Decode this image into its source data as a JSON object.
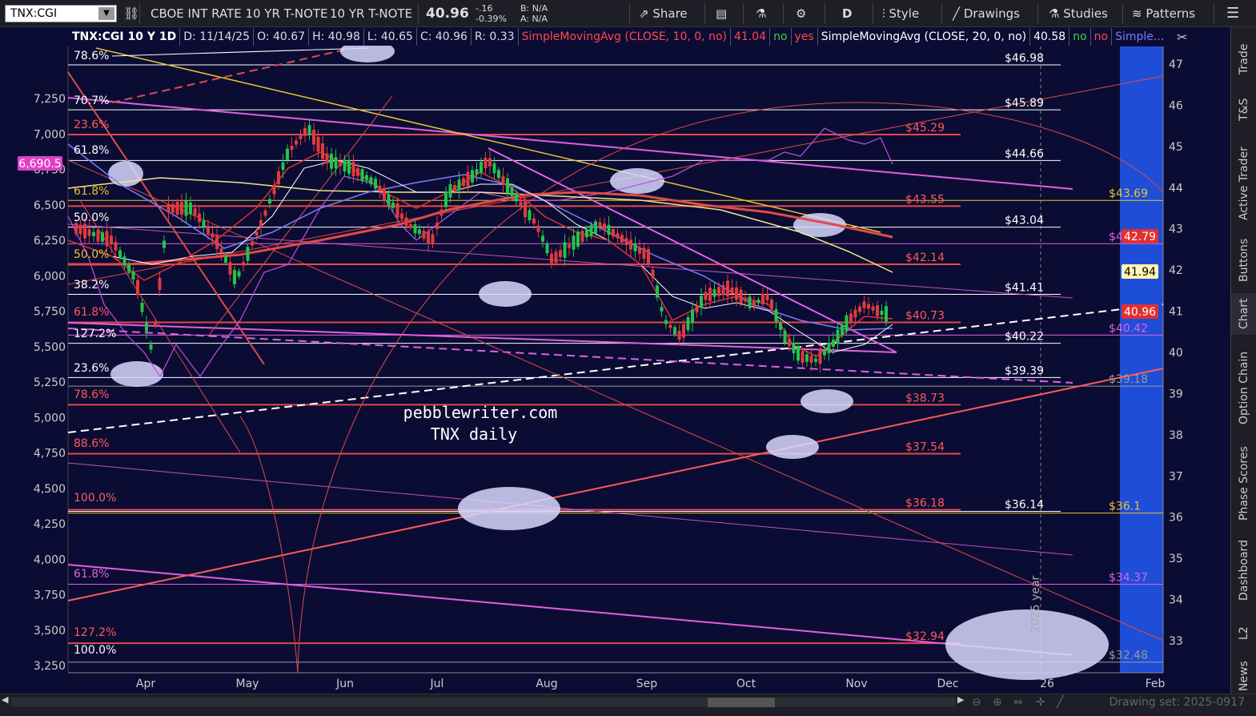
{
  "toolbar": {
    "symbol": "TNX:CGI",
    "description": "CBOE INT RATE 10 YR T-NOTE",
    "short_description": "10 YR T-NOTE",
    "last_price": "40.96",
    "change": "-.16",
    "change_pct": "-0.39%",
    "bid": "B: N/A",
    "ask": "A: N/A",
    "share_label": "Share",
    "period_label": "D",
    "style_label": "Style",
    "drawings_label": "Drawings",
    "studies_label": "Studies",
    "patterns_label": "Patterns"
  },
  "infobar": {
    "title": "TNX:CGI 10 Y 1D",
    "date": "D: 11/14/25",
    "open": "O: 40.67",
    "high": "H: 40.98",
    "low": "L: 40.65",
    "close": "C: 40.96",
    "range": "R: 0.33",
    "study1": "SimpleMovingAvg (CLOSE, 10, 0, no)",
    "study1_val": "41.04",
    "study1_no": "no",
    "study1_yes": "yes",
    "study2": "SimpleMovingAvg (CLOSE, 20, 0, no)",
    "study2_val": "40.58",
    "study2_no1": "no",
    "study2_no2": "no",
    "study3": "Simple..."
  },
  "watermark": {
    "line1": "pebblewriter.com",
    "line2": "TNX daily"
  },
  "year_marker": "2025 year",
  "chart_data": {
    "type": "line",
    "x_ticks": [
      "Apr",
      "May",
      "Jun",
      "Jul",
      "Aug",
      "Sep",
      "Oct",
      "Nov",
      "Dec",
      "26",
      "Feb"
    ],
    "right_axis_ticks": [
      "47",
      "46",
      "45",
      "44",
      "43",
      "42",
      "41",
      "40",
      "39",
      "38",
      "37",
      "36",
      "35",
      "34",
      "33"
    ],
    "left_axis_ticks": [
      "7,250",
      "7,000",
      "6,750",
      "6,500",
      "6,250",
      "6,000",
      "5,750",
      "5,500",
      "5,250",
      "5,000",
      "4,750",
      "4,500",
      "4,250",
      "4,000",
      "3,750",
      "3,500",
      "3,250"
    ],
    "y_right_range": [
      32.5,
      47.5
    ],
    "y_left_range": [
      3200,
      7450
    ],
    "price_labels_white": [
      "$46.98",
      "$45.89",
      "$44.66",
      "$43.04",
      "$41.41",
      "$40.22",
      "$39.39",
      "$36.14"
    ],
    "price_labels_red": [
      "$45.29",
      "$43.55",
      "$42.14",
      "$40.73",
      "$38.73",
      "$37.54",
      "$36.18",
      "$32.94"
    ],
    "price_labels_yellow": [
      "$43.69",
      "$36.1"
    ],
    "price_labels_pink": [
      "$42.64",
      "$40.42",
      "$34.37"
    ],
    "price_labels_faint": [
      "$39.18",
      "$32.48"
    ],
    "fib_labels_white": [
      "78.6%",
      "70.7%",
      "61.8%",
      "50.0%",
      "38.2%",
      "127.2%",
      "23.6%",
      "100.0%"
    ],
    "fib_labels_red": [
      "23.6%",
      "61.8%",
      "78.6%",
      "88.6%",
      "100.0%",
      "127.2%"
    ],
    "fib_labels_yellow": [
      "61.8%",
      "50.0%"
    ],
    "fib_labels_pink": [
      "61.8%"
    ],
    "badges": [
      {
        "text": "6,690.5",
        "bg": "#e040c8",
        "fg": "#ffffff"
      },
      {
        "text": "42.79",
        "bg": "#e03030",
        "fg": "#ffffff"
      },
      {
        "text": "41.94",
        "bg": "#fff5b0",
        "fg": "#000000"
      },
      {
        "text": "40.96",
        "bg": "#e03030",
        "fg": "#ffffff"
      }
    ],
    "colors": {
      "background": "#0b0c33",
      "up_candle": "#21c44a",
      "down_candle": "#e03b3b",
      "sma10": "#e03030",
      "sma20": "#ffffff",
      "sma50": "#7b7bff",
      "sma200": "#f0e68c",
      "spx_line": "#c050e0",
      "future_band": "#1e4ed8"
    }
  },
  "right_panel": {
    "tabs": [
      "Trade",
      "T&S",
      "Active Trader",
      "Buttons",
      "Chart",
      "Option Chain",
      "Phase Scores",
      "Dashboard",
      "L2",
      "News"
    ],
    "active": "Chart"
  },
  "bottombar": {
    "drawing_set": "Drawing set: 2025-0917"
  }
}
